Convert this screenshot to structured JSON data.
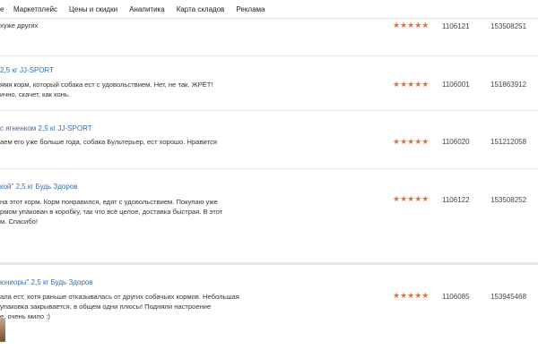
{
  "nav": [
    "е",
    "Маркетплейс",
    "Цены и скидки",
    "Аналитика",
    "Карта складов",
    "Реклама"
  ],
  "reviews": [
    {
      "product": "",
      "text": [
        "хуже других"
      ],
      "rating": "★★★★★",
      "id1": "1106121",
      "id2": "153508251"
    },
    {
      "product": "2,5 кг JJ-SPORT",
      "text": [
        "ямя корм, который собака ест с удовольствием. Нет, не так. ЖРЁТ!",
        "ично, скачет, как конь."
      ],
      "rating": "★★★★★",
      "id1": "1106001",
      "id2": "151863912"
    },
    {
      "product": "с ягненком 2,5 кг JJ-SPORT",
      "text": [
        "аем его уже больше года, собака Бультерьер, ест хорошо. Нравится"
      ],
      "rating": "★★★★★",
      "id1": "1106020",
      "id2": "151212058"
    },
    {
      "product": "кой\" 2,5 кг Будь Здоров",
      "text": [
        "на этот корм. Корм понравился, едят с удовольствием. Покупаю уже",
        "рмом упакован в коробку, так что всё целое, доставка быстрая. В этот",
        "м. Спасибо!"
      ],
      "rating": "★★★★★",
      "id1": "1106122",
      "id2": "153508252"
    },
    {
      "product": "юниоры\" 2,5 кг Будь Здоров",
      "text": [
        "ала ест, хотя раньше отказывалась от других собачьих кормов. Небольшая",
        "упаковка закрывается, в общем одни плюсы! Подняли настроение",
        "е, очень мило :)"
      ],
      "rating": "★★★★★",
      "id1": "1106085",
      "id2": "153945468"
    }
  ],
  "colors": {
    "accent": "#2f6fb7",
    "stars": "#f26b2e"
  }
}
